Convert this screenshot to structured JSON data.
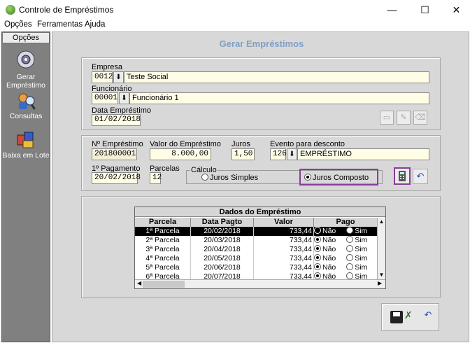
{
  "window": {
    "title": "Controle de Empréstimos",
    "minimize": "—",
    "maximize": "☐",
    "close": "✕"
  },
  "menu": [
    "Opções",
    "Ferramentas",
    "Ajuda"
  ],
  "sidebar": {
    "header": "Opções",
    "items": [
      {
        "label": "Gerar Empréstimo",
        "icon": "gear-disk-icon"
      },
      {
        "label": "Consultas",
        "icon": "search-people-icon"
      },
      {
        "label": "Baixa em Lote",
        "icon": "boxes-icon"
      }
    ]
  },
  "form": {
    "title": "Gerar Empréstimos",
    "empresa": {
      "label": "Empresa",
      "code": "0012",
      "name": "Teste Social"
    },
    "funcionario": {
      "label": "Funcionário",
      "code": "00001",
      "name": "Funcionário 1"
    },
    "data_emprestimo": {
      "label": "Data Empréstimo",
      "value": "01/02/2018"
    },
    "n_emprestimo": {
      "label": "Nº Empréstimo",
      "value": "201800001"
    },
    "valor": {
      "label": "Valor do Empréstimo",
      "value": "8.000,00"
    },
    "juros": {
      "label": "Juros",
      "value": "1,50"
    },
    "evento": {
      "label": "Evento para desconto",
      "code": "126",
      "name": "EMPRÉSTIMO"
    },
    "primeiro_pagamento": {
      "label": "1º Pagamento",
      "value": "20/02/2018"
    },
    "parcelas": {
      "label": "Parcelas",
      "value": "12"
    },
    "calculo": {
      "label": "Cálculo",
      "simples": "Juros Simples",
      "composto": "Juros Composto",
      "selected": "composto"
    }
  },
  "grid": {
    "caption": "Dados do Empréstimo",
    "columns": [
      "Parcela",
      "Data Pagto",
      "Valor",
      "Pago"
    ],
    "pago_options": [
      "Não",
      "Sim"
    ],
    "rows": [
      {
        "parcela": "1ª Parcela",
        "data": "20/02/2018",
        "valor": "733,44",
        "pago": "Não"
      },
      {
        "parcela": "2ª Parcela",
        "data": "20/03/2018",
        "valor": "733,44",
        "pago": "Não"
      },
      {
        "parcela": "3ª Parcela",
        "data": "20/04/2018",
        "valor": "733,44",
        "pago": "Não"
      },
      {
        "parcela": "4ª Parcela",
        "data": "20/05/2018",
        "valor": "733,44",
        "pago": "Não"
      },
      {
        "parcela": "5ª Parcela",
        "data": "20/06/2018",
        "valor": "733,44",
        "pago": "Não"
      },
      {
        "parcela": "6ª Parcela",
        "data": "20/07/2018",
        "valor": "733,44",
        "pago": "Não"
      }
    ]
  },
  "accent_colors": {
    "highlight_border": "#8a3d9a",
    "title_blue": "#7f9fc6",
    "field_bg": "#fffde6"
  }
}
